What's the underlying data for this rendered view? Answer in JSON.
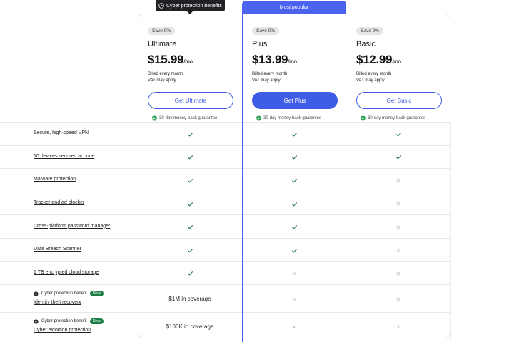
{
  "tooltip": {
    "label": "Cyber protection benefits"
  },
  "banner": {
    "label": "Most popular"
  },
  "plans": [
    {
      "badge": "Save 0%",
      "name": "Ultimate",
      "price": "$15.99",
      "per": "/mo",
      "billed": "Billed every month",
      "vat": "VAT may apply",
      "button": "Get Ultimate",
      "guarantee": "30-day money-back guarantee"
    },
    {
      "badge": "Save 0%",
      "name": "Plus",
      "price": "$13.99",
      "per": "/mo",
      "billed": "Billed every month",
      "vat": "VAT may apply",
      "button": "Get Plus",
      "guarantee": "30-day money-back guarantee"
    },
    {
      "badge": "Save 0%",
      "name": "Basic",
      "price": "$12.99",
      "per": "/mo",
      "billed": "Billed every month",
      "vat": "VAT may apply",
      "button": "Get Basic",
      "guarantee": "30-day money-back guarantee"
    }
  ],
  "features": [
    {
      "label": "Secure, high-speed VPN",
      "ultimate": "check",
      "plus": "check",
      "basic": "check"
    },
    {
      "label": "10 devices secured at once",
      "ultimate": "check",
      "plus": "check",
      "basic": "check"
    },
    {
      "label": "Malware protection",
      "ultimate": "check",
      "plus": "check",
      "basic": "cross"
    },
    {
      "label": "Tracker and ad blocker",
      "ultimate": "check",
      "plus": "check",
      "basic": "cross"
    },
    {
      "label": "Cross-platform password manager",
      "ultimate": "check",
      "plus": "check",
      "basic": "cross"
    },
    {
      "label": "Data Breach Scanner",
      "ultimate": "check",
      "plus": "check",
      "basic": "cross"
    },
    {
      "label": "1 TB encrypted cloud storage",
      "ultimate": "check",
      "plus": "cross",
      "basic": "cross"
    }
  ],
  "cyber_rows": [
    {
      "benefit_label": "Cyber protection benefit",
      "new_badge": "New",
      "label": "Identity theft recovery",
      "ultimate": "$1M in coverage",
      "plus": "cross",
      "basic": "cross"
    },
    {
      "benefit_label": "Cyber protection benefit",
      "new_badge": "New",
      "label": "Cyber extortion protection",
      "ultimate": "$100K in coverage",
      "plus": "cross",
      "basic": "cross"
    }
  ],
  "colors": {
    "accent": "#3e5ce6",
    "check": "#1c7c43",
    "cross": "#c4c4c8",
    "new_badge": "#1c7c43"
  }
}
